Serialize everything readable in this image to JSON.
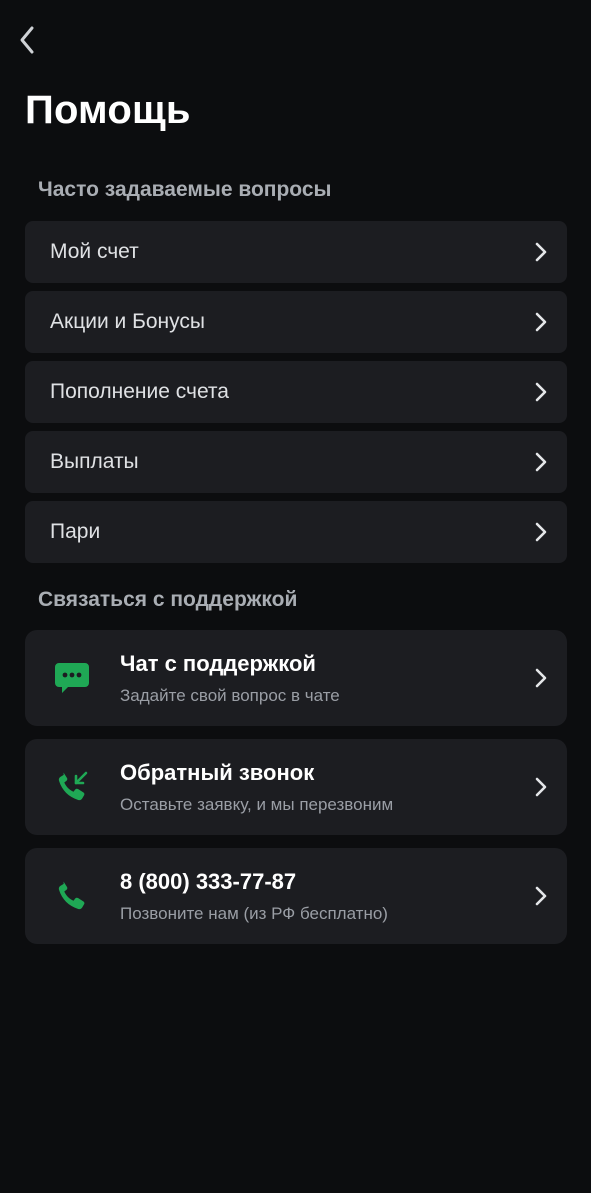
{
  "header": {
    "title": "Помощь"
  },
  "faq": {
    "section_title": "Часто задаваемые вопросы",
    "items": [
      {
        "label": "Мой счет"
      },
      {
        "label": "Акции и Бонусы"
      },
      {
        "label": "Пополнение счета"
      },
      {
        "label": "Выплаты"
      },
      {
        "label": "Пари"
      }
    ]
  },
  "support": {
    "section_title": "Связаться с поддержкой",
    "items": [
      {
        "title": "Чат с поддержкой",
        "subtitle": "Задайте свой вопрос в чате",
        "icon": "chat-icon"
      },
      {
        "title": "Обратный звонок",
        "subtitle": "Оставьте заявку, и мы перезвоним",
        "icon": "callback-phone-icon"
      },
      {
        "title": "8 (800) 333-77-87",
        "subtitle": "Позвоните нам (из РФ бесплатно)",
        "icon": "phone-icon"
      }
    ]
  },
  "colors": {
    "background": "#0c0d0f",
    "card": "#1c1d21",
    "accent_green": "#1fa855",
    "muted_text": "#a9adb3"
  }
}
